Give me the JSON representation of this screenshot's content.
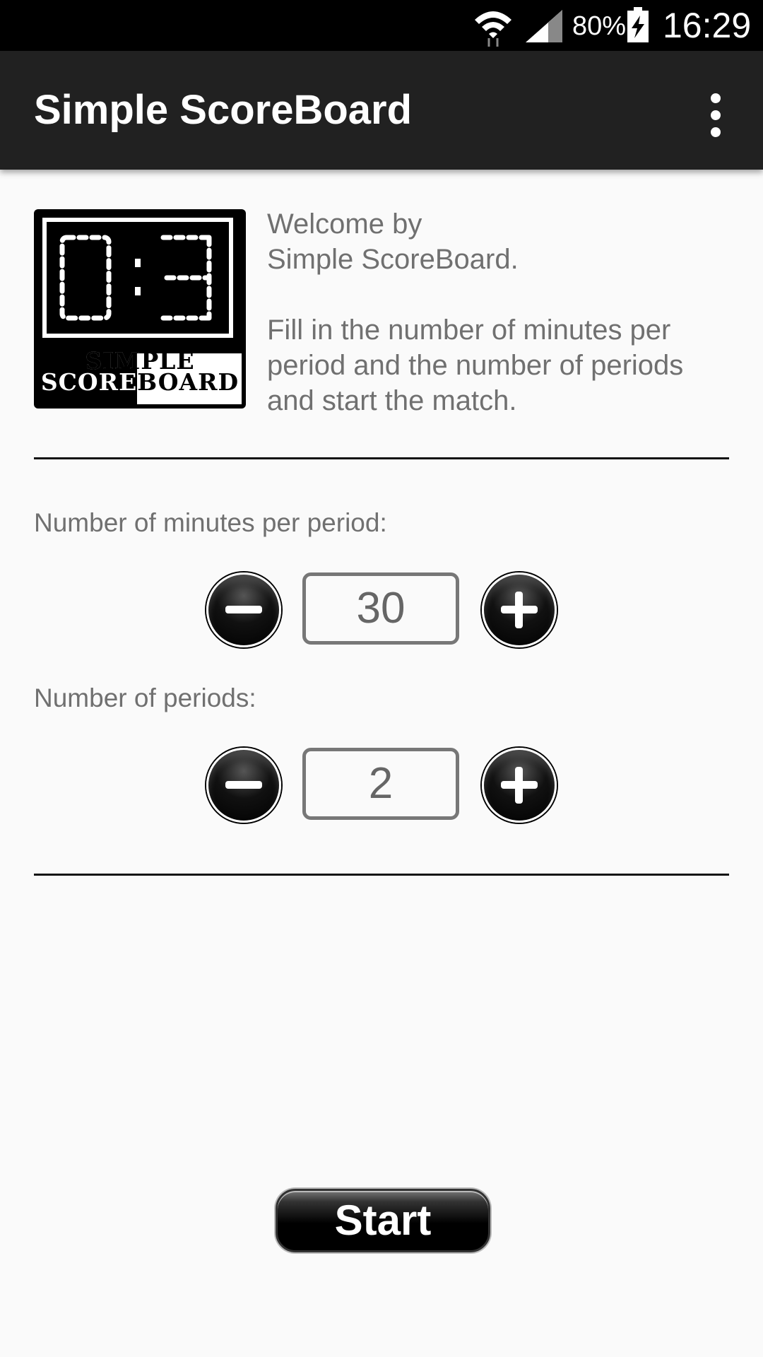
{
  "status_bar": {
    "battery_percent": "80%",
    "time": "16:29",
    "icons": [
      "wifi-icon",
      "cell-signal-icon",
      "battery-charging-icon"
    ]
  },
  "app_bar": {
    "title": "Simple ScoreBoard",
    "menu_icon": "more-vert-icon"
  },
  "logo": {
    "line1": "SIMPLE",
    "line2": "SCOREBOARD",
    "display": "0:3"
  },
  "welcome": {
    "text": "Welcome by\nSimple ScoreBoard.\n\nFill in the number of minutes per period and the number of periods and start the match."
  },
  "minutes": {
    "label": "Number of minutes per period:",
    "value": "30"
  },
  "periods": {
    "label": "Number of periods:",
    "value": "2"
  },
  "start_button": {
    "label": "Start"
  },
  "colors": {
    "background": "#fafafa",
    "app_bar": "#212121",
    "status_bar": "#000000",
    "text_gray": "#707070"
  }
}
